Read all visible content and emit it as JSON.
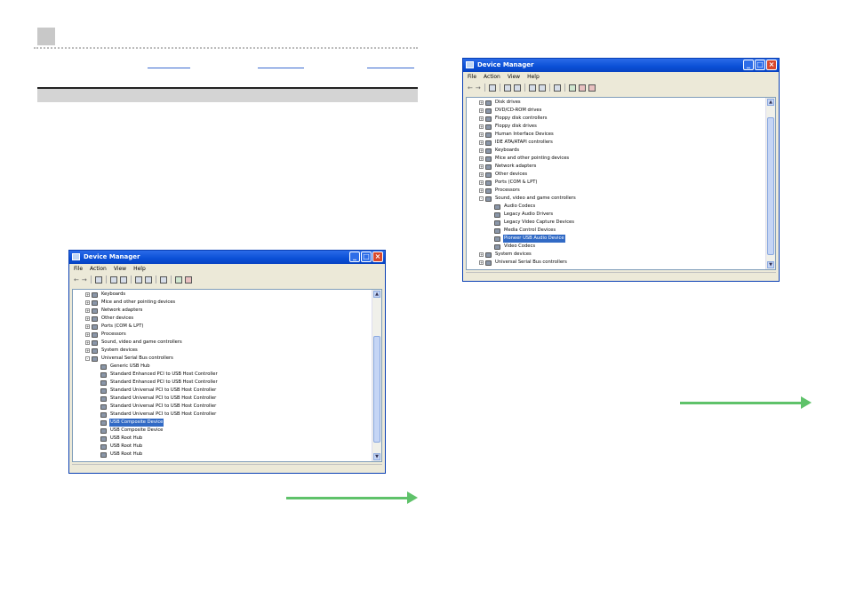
{
  "window_left": {
    "title": "Device Manager",
    "menu": [
      "File",
      "Action",
      "View",
      "Help"
    ],
    "tree": [
      {
        "label": "Keyboards",
        "level": 1,
        "expander": "+"
      },
      {
        "label": "Mice and other pointing devices",
        "level": 1,
        "expander": "+"
      },
      {
        "label": "Network adapters",
        "level": 1,
        "expander": "+"
      },
      {
        "label": "Other devices",
        "level": 1,
        "expander": "+"
      },
      {
        "label": "Ports (COM & LPT)",
        "level": 1,
        "expander": "+"
      },
      {
        "label": "Processors",
        "level": 1,
        "expander": "+"
      },
      {
        "label": "Sound, video and game controllers",
        "level": 1,
        "expander": "+"
      },
      {
        "label": "System devices",
        "level": 1,
        "expander": "+"
      },
      {
        "label": "Universal Serial Bus controllers",
        "level": 1,
        "expander": "-"
      },
      {
        "label": "Generic USB Hub",
        "level": 2
      },
      {
        "label": "Standard Enhanced PCI to USB Host Controller",
        "level": 2
      },
      {
        "label": "Standard Enhanced PCI to USB Host Controller",
        "level": 2
      },
      {
        "label": "Standard Universal PCI to USB Host Controller",
        "level": 2
      },
      {
        "label": "Standard Universal PCI to USB Host Controller",
        "level": 2
      },
      {
        "label": "Standard Universal PCI to USB Host Controller",
        "level": 2
      },
      {
        "label": "Standard Universal PCI to USB Host Controller",
        "level": 2
      },
      {
        "label": "USB Composite Device",
        "level": 2,
        "selected": true
      },
      {
        "label": "USB Composite Device",
        "level": 2
      },
      {
        "label": "USB Root Hub",
        "level": 2
      },
      {
        "label": "USB Root Hub",
        "level": 2
      },
      {
        "label": "USB Root Hub",
        "level": 2
      }
    ]
  },
  "window_right": {
    "title": "Device Manager",
    "menu": [
      "File",
      "Action",
      "View",
      "Help"
    ],
    "tree": [
      {
        "label": "Disk drives",
        "level": 1,
        "expander": "+"
      },
      {
        "label": "DVD/CD-ROM drives",
        "level": 1,
        "expander": "+"
      },
      {
        "label": "Floppy disk controllers",
        "level": 1,
        "expander": "+"
      },
      {
        "label": "Floppy disk drives",
        "level": 1,
        "expander": "+"
      },
      {
        "label": "Human Interface Devices",
        "level": 1,
        "expander": "+"
      },
      {
        "label": "IDE ATA/ATAPI controllers",
        "level": 1,
        "expander": "+"
      },
      {
        "label": "Keyboards",
        "level": 1,
        "expander": "+"
      },
      {
        "label": "Mice and other pointing devices",
        "level": 1,
        "expander": "+"
      },
      {
        "label": "Network adapters",
        "level": 1,
        "expander": "+"
      },
      {
        "label": "Other devices",
        "level": 1,
        "expander": "+"
      },
      {
        "label": "Ports (COM & LPT)",
        "level": 1,
        "expander": "+"
      },
      {
        "label": "Processors",
        "level": 1,
        "expander": "+"
      },
      {
        "label": "Sound, video and game controllers",
        "level": 1,
        "expander": "-"
      },
      {
        "label": "Audio Codecs",
        "level": 2
      },
      {
        "label": "Legacy Audio Drivers",
        "level": 2
      },
      {
        "label": "Legacy Video Capture Devices",
        "level": 2
      },
      {
        "label": "Media Control Devices",
        "level": 2
      },
      {
        "label": "Pioneer USB Audio Device",
        "level": 2,
        "selected": true
      },
      {
        "label": "Video Codecs",
        "level": 2
      },
      {
        "label": "System devices",
        "level": 1,
        "expander": "+"
      },
      {
        "label": "Universal Serial Bus controllers",
        "level": 1,
        "expander": "+"
      }
    ]
  },
  "colors": {
    "accent_green": "#5fc26a",
    "link_blue": "#3a6bd0",
    "title_blue": "#0a4fd6",
    "selection_blue": "#316ac5"
  },
  "icons": {
    "title": "device-manager-icon",
    "toolbar": [
      "back-arrow-icon",
      "forward-arrow-icon",
      "properties-icon",
      "computer-icon",
      "print-icon",
      "help-icon",
      "view-icon",
      "scan-hardware-icon",
      "update-driver-icon",
      "uninstall-icon",
      "disable-icon"
    ]
  }
}
